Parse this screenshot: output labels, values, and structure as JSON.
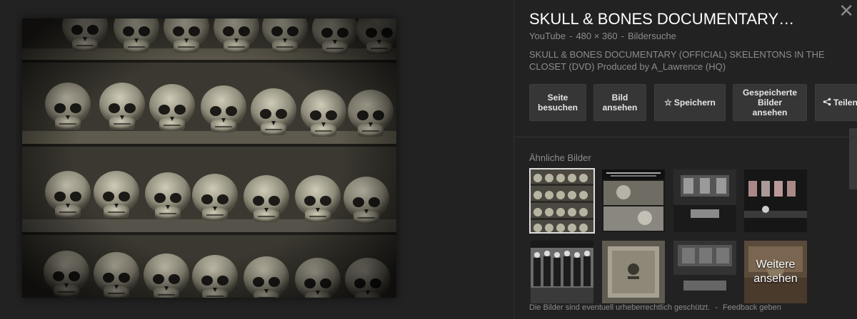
{
  "panel": {
    "title": "SKULL & BONES DOCUMENTARY…",
    "source": "YouTube",
    "dimensions": "480 × 360",
    "search_type": "Bildersuche",
    "description": "SKULL & BONES DOCUMENTARY (OFFICIAL) SKELENTONS IN THE CLOSET (DVD) Produced by A_Lawrence (HQ)"
  },
  "buttons": {
    "visit": "Seite besuchen",
    "view": "Bild ansehen",
    "save": "Speichern",
    "saved": "Gespeicherte Bilder ansehen",
    "share": "Teilen"
  },
  "similar": {
    "label": "Ähnliche Bilder",
    "more": "Weitere ansehen"
  },
  "footer": {
    "copyright": "Die Bilder sind eventuell urheberrechtlich geschützt.",
    "separator": "-",
    "feedback": "Feedback geben"
  },
  "icons": {
    "close": "close-icon",
    "save": "star-icon",
    "share": "share-icon"
  },
  "colors": {
    "background": "#222222",
    "button": "#363636",
    "muted_text": "#8c8c8c"
  }
}
